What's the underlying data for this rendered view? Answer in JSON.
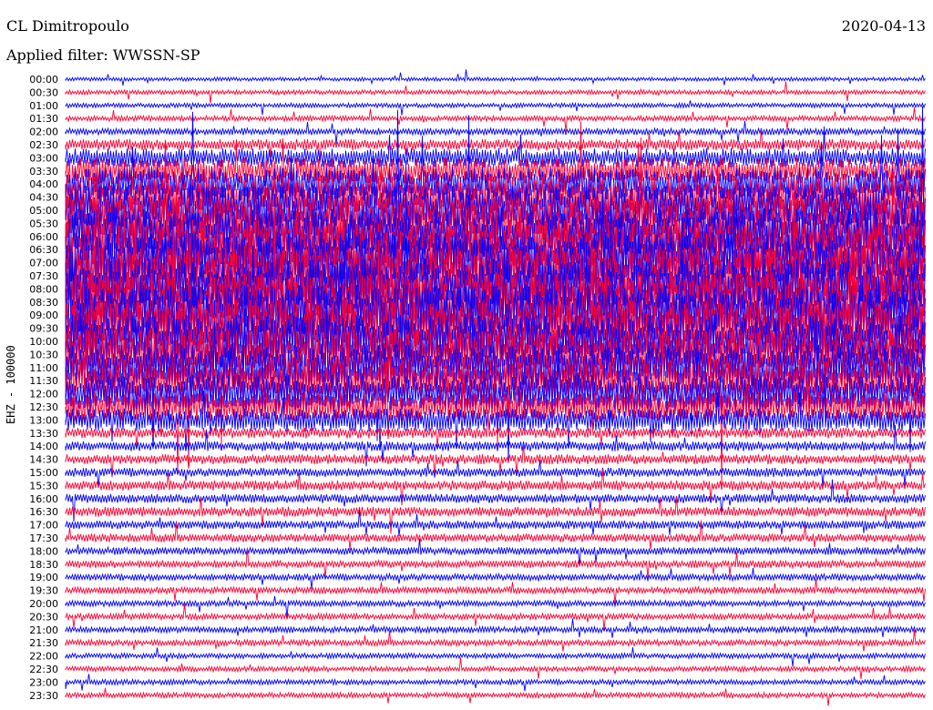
{
  "header": {
    "station": "CL Dimitropoulo",
    "date": "2020-04-13",
    "filter": "Applied filter: WWSSN-SP"
  },
  "chart_data": {
    "type": "line",
    "title": "CL Dimitropoulo",
    "ylabel": "EHZ - 100000",
    "colors": [
      "#0000ff",
      "#ff0033"
    ],
    "rows": [
      {
        "time": "00:00",
        "color": "#0000ff",
        "amplitude": 0.5
      },
      {
        "time": "00:30",
        "color": "#ff0033",
        "amplitude": 0.6
      },
      {
        "time": "01:00",
        "color": "#0000ff",
        "amplitude": 0.6
      },
      {
        "time": "01:30",
        "color": "#ff0033",
        "amplitude": 0.7
      },
      {
        "time": "02:00",
        "color": "#0000ff",
        "amplitude": 0.9
      },
      {
        "time": "02:30",
        "color": "#ff0033",
        "amplitude": 1.5
      },
      {
        "time": "03:00",
        "color": "#0000ff",
        "amplitude": 2.5
      },
      {
        "time": "03:30",
        "color": "#ff0033",
        "amplitude": 3.5
      },
      {
        "time": "04:00",
        "color": "#0000ff",
        "amplitude": 4.5
      },
      {
        "time": "04:30",
        "color": "#ff0033",
        "amplitude": 5.5
      },
      {
        "time": "05:00",
        "color": "#0000ff",
        "amplitude": 6.5
      },
      {
        "time": "05:30",
        "color": "#ff0033",
        "amplitude": 7.0
      },
      {
        "time": "06:00",
        "color": "#0000ff",
        "amplitude": 7.5
      },
      {
        "time": "06:30",
        "color": "#ff0033",
        "amplitude": 8.0
      },
      {
        "time": "07:00",
        "color": "#0000ff",
        "amplitude": 8.0
      },
      {
        "time": "07:30",
        "color": "#ff0033",
        "amplitude": 8.0
      },
      {
        "time": "08:00",
        "color": "#0000ff",
        "amplitude": 8.0
      },
      {
        "time": "08:30",
        "color": "#ff0033",
        "amplitude": 8.0
      },
      {
        "time": "09:00",
        "color": "#0000ff",
        "amplitude": 8.0
      },
      {
        "time": "09:30",
        "color": "#ff0033",
        "amplitude": 7.5
      },
      {
        "time": "10:00",
        "color": "#0000ff",
        "amplitude": 7.0
      },
      {
        "time": "10:30",
        "color": "#ff0033",
        "amplitude": 6.5
      },
      {
        "time": "11:00",
        "color": "#0000ff",
        "amplitude": 6.0
      },
      {
        "time": "11:30",
        "color": "#ff0033",
        "amplitude": 5.5
      },
      {
        "time": "12:00",
        "color": "#0000ff",
        "amplitude": 5.0
      },
      {
        "time": "12:30",
        "color": "#ff0033",
        "amplitude": 4.0
      },
      {
        "time": "13:00",
        "color": "#0000ff",
        "amplitude": 3.0
      },
      {
        "time": "13:30",
        "color": "#ff0033",
        "amplitude": 1.4
      },
      {
        "time": "14:00",
        "color": "#0000ff",
        "amplitude": 1.3
      },
      {
        "time": "14:30",
        "color": "#ff0033",
        "amplitude": 1.3
      },
      {
        "time": "15:00",
        "color": "#0000ff",
        "amplitude": 1.2
      },
      {
        "time": "15:30",
        "color": "#ff0033",
        "amplitude": 1.3
      },
      {
        "time": "16:00",
        "color": "#0000ff",
        "amplitude": 1.2
      },
      {
        "time": "16:30",
        "color": "#ff0033",
        "amplitude": 1.3
      },
      {
        "time": "17:00",
        "color": "#0000ff",
        "amplitude": 1.1
      },
      {
        "time": "17:30",
        "color": "#ff0033",
        "amplitude": 1.1
      },
      {
        "time": "18:00",
        "color": "#0000ff",
        "amplitude": 1.0
      },
      {
        "time": "18:30",
        "color": "#ff0033",
        "amplitude": 1.0
      },
      {
        "time": "19:00",
        "color": "#0000ff",
        "amplitude": 0.9
      },
      {
        "time": "19:30",
        "color": "#ff0033",
        "amplitude": 0.9
      },
      {
        "time": "20:00",
        "color": "#0000ff",
        "amplitude": 0.8
      },
      {
        "time": "20:30",
        "color": "#ff0033",
        "amplitude": 0.8
      },
      {
        "time": "21:00",
        "color": "#0000ff",
        "amplitude": 0.8
      },
      {
        "time": "21:30",
        "color": "#ff0033",
        "amplitude": 0.8
      },
      {
        "time": "22:00",
        "color": "#0000ff",
        "amplitude": 0.7
      },
      {
        "time": "22:30",
        "color": "#ff0033",
        "amplitude": 0.7
      },
      {
        "time": "23:00",
        "color": "#0000ff",
        "amplitude": 0.7
      },
      {
        "time": "23:30",
        "color": "#ff0033",
        "amplitude": 0.7
      }
    ]
  }
}
